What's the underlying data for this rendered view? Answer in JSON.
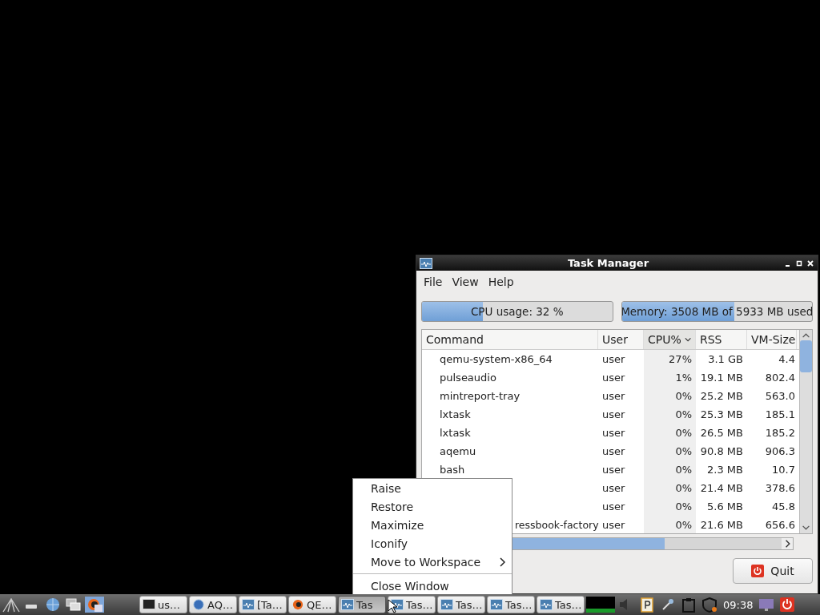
{
  "window": {
    "title": "Task Manager",
    "menu": [
      "File",
      "View",
      "Help"
    ],
    "cpu_bar": {
      "label": "CPU usage: 32 %",
      "level": 0.32
    },
    "memory_bar": {
      "label": "Memory: 3508 MB of 5933 MB used",
      "level": 0.59
    },
    "table": {
      "columns": [
        {
          "label": "Command",
          "sorted": false
        },
        {
          "label": "User",
          "sorted": false
        },
        {
          "label": "CPU%",
          "sorted": true
        },
        {
          "label": "RSS",
          "sorted": false
        },
        {
          "label": "VM-Size",
          "sorted": false
        }
      ],
      "rows": [
        {
          "kind": "normal",
          "command": "qemu-system-x86_64",
          "user": "user",
          "cpu": "27%",
          "rss": "3.1 GB",
          "vm_size": "4.4"
        },
        {
          "kind": "normal",
          "command": "pulseaudio",
          "user": "user",
          "cpu": "1%",
          "rss": "19.1 MB",
          "vm_size": "802.4"
        },
        {
          "kind": "normal",
          "command": "mintreport-tray",
          "user": "user",
          "cpu": "0%",
          "rss": "25.2 MB",
          "vm_size": "563.0"
        },
        {
          "kind": "normal",
          "command": "lxtask",
          "user": "user",
          "cpu": "0%",
          "rss": "25.3 MB",
          "vm_size": "185.1"
        },
        {
          "kind": "normal",
          "command": "lxtask",
          "user": "user",
          "cpu": "0%",
          "rss": "26.5 MB",
          "vm_size": "185.2"
        },
        {
          "kind": "normal",
          "command": "aqemu",
          "user": "user",
          "cpu": "0%",
          "rss": "90.8 MB",
          "vm_size": "906.3"
        },
        {
          "kind": "normal",
          "command": "bash",
          "user": "user",
          "cpu": "0%",
          "rss": "2.3 MB",
          "vm_size": "10.7"
        },
        {
          "kind": "hidden",
          "user": "user",
          "cpu": "0%",
          "rss": "21.4 MB",
          "vm_size": "378.6"
        },
        {
          "kind": "hidden",
          "user": "user",
          "cpu": "0%",
          "rss": "5.6 MB",
          "vm_size": "45.8"
        },
        {
          "kind": "covered",
          "command": "ressbook-factory",
          "user": "user",
          "cpu": "0%",
          "rss": "21.6 MB",
          "vm_size": "656.6"
        }
      ]
    },
    "quit_button": "Quit"
  },
  "context_menu": {
    "items": [
      {
        "kind": "item",
        "label": "Raise"
      },
      {
        "kind": "item",
        "label": "Restore"
      },
      {
        "kind": "item",
        "label": "Maximize"
      },
      {
        "kind": "item",
        "label": "Iconify"
      },
      {
        "kind": "submenu",
        "label": "Move to Workspace"
      },
      {
        "kind": "separator"
      },
      {
        "kind": "item",
        "label": "Close Window"
      }
    ]
  },
  "taskbar": {
    "tasks": [
      {
        "kind": "terminal",
        "label": "us…",
        "selected": false
      },
      {
        "kind": "globe",
        "label": "AQ…",
        "selected": false
      },
      {
        "kind": "monitor",
        "label": "[Ta…",
        "selected": false
      },
      {
        "kind": "qemu",
        "label": "QE…",
        "selected": false
      },
      {
        "kind": "monitor",
        "label": "Tas",
        "selected": true
      },
      {
        "kind": "monitor",
        "label": "Tas…",
        "selected": false
      },
      {
        "kind": "monitor",
        "label": "Tas…",
        "selected": false
      },
      {
        "kind": "monitor",
        "label": "Tas…",
        "selected": false
      },
      {
        "kind": "monitor",
        "label": "Tas…",
        "selected": false
      }
    ],
    "clock": "09:38"
  }
}
